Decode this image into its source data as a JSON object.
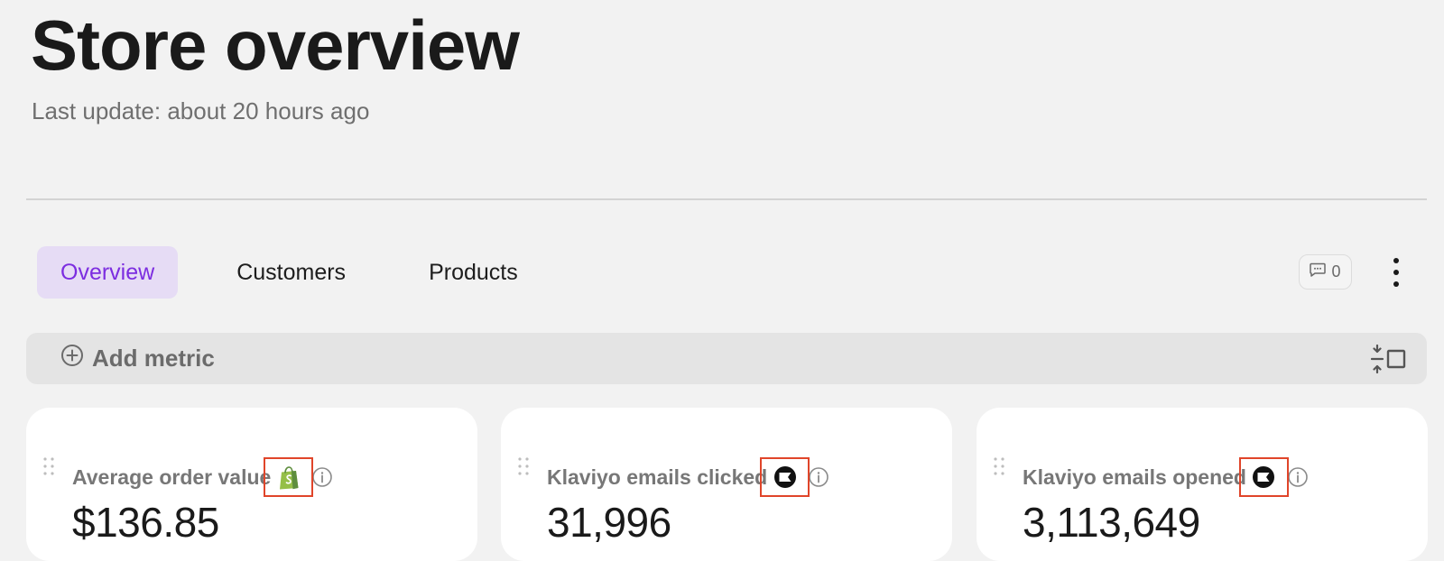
{
  "header": {
    "title": "Store overview",
    "last_update": "Last update: about 20 hours ago"
  },
  "tabs": [
    {
      "label": "Overview",
      "active": true
    },
    {
      "label": "Customers",
      "active": false
    },
    {
      "label": "Products",
      "active": false
    }
  ],
  "toolbar": {
    "comment_count": "0",
    "comment_icon": "chat-bubble-icon",
    "more_icon": "vertical-ellipsis-icon"
  },
  "metric_bar": {
    "add_label": "Add metric",
    "add_icon": "plus-circle-icon",
    "layout_icon": "collapse-layout-icon"
  },
  "cards": [
    {
      "title": "Average order value",
      "source_icon": "shopify-bag-icon",
      "value": "$136.85"
    },
    {
      "title": "Klaviyo emails clicked",
      "source_icon": "klaviyo-flag-icon",
      "value": "31,996"
    },
    {
      "title": "Klaviyo emails opened",
      "source_icon": "klaviyo-flag-icon",
      "value": "3,113,649"
    }
  ],
  "colors": {
    "accent": "#7c2de0",
    "accent_bg": "#e6dcf5",
    "highlight_border": "#e0452a",
    "shopify_green": "#95bf47"
  }
}
